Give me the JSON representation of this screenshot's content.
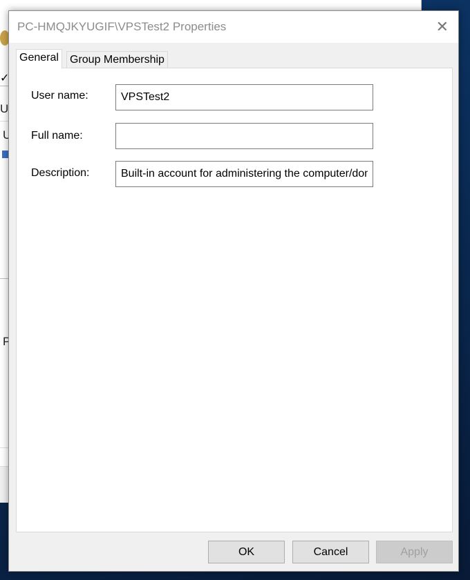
{
  "background_window": {
    "fragments": [
      "Us",
      "U",
      "P"
    ]
  },
  "dialog": {
    "title": "PC-HMQJKYUGIF\\VPSTest2 Properties",
    "close_icon": "close-icon",
    "tabs": [
      {
        "label": "General",
        "active": true
      },
      {
        "label": "Group Membership",
        "active": false
      }
    ],
    "fields": [
      {
        "label": "User name:",
        "value": "VPSTest2"
      },
      {
        "label": "Full name:",
        "value": ""
      },
      {
        "label": "Description:",
        "value": "Built-in account for administering the computer/domain"
      }
    ],
    "buttons": {
      "ok": "OK",
      "cancel": "Cancel",
      "apply": "Apply",
      "apply_enabled": false
    }
  }
}
